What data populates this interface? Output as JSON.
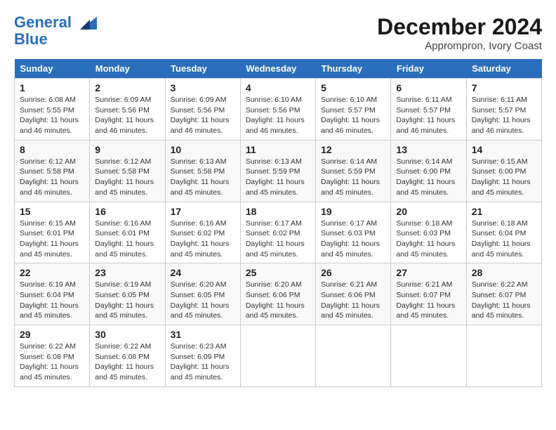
{
  "header": {
    "logo_line1": "General",
    "logo_line2": "Blue",
    "month": "December 2024",
    "location": "Apprompron, Ivory Coast"
  },
  "columns": [
    "Sunday",
    "Monday",
    "Tuesday",
    "Wednesday",
    "Thursday",
    "Friday",
    "Saturday"
  ],
  "weeks": [
    [
      {
        "day": "1",
        "sunrise": "6:08 AM",
        "sunset": "5:55 PM",
        "daylight": "11 hours and 46 minutes."
      },
      {
        "day": "2",
        "sunrise": "6:09 AM",
        "sunset": "5:56 PM",
        "daylight": "11 hours and 46 minutes."
      },
      {
        "day": "3",
        "sunrise": "6:09 AM",
        "sunset": "5:56 PM",
        "daylight": "11 hours and 46 minutes."
      },
      {
        "day": "4",
        "sunrise": "6:10 AM",
        "sunset": "5:56 PM",
        "daylight": "11 hours and 46 minutes."
      },
      {
        "day": "5",
        "sunrise": "6:10 AM",
        "sunset": "5:57 PM",
        "daylight": "11 hours and 46 minutes."
      },
      {
        "day": "6",
        "sunrise": "6:11 AM",
        "sunset": "5:57 PM",
        "daylight": "11 hours and 46 minutes."
      },
      {
        "day": "7",
        "sunrise": "6:11 AM",
        "sunset": "5:57 PM",
        "daylight": "11 hours and 46 minutes."
      }
    ],
    [
      {
        "day": "8",
        "sunrise": "6:12 AM",
        "sunset": "5:58 PM",
        "daylight": "11 hours and 46 minutes."
      },
      {
        "day": "9",
        "sunrise": "6:12 AM",
        "sunset": "5:58 PM",
        "daylight": "11 hours and 45 minutes."
      },
      {
        "day": "10",
        "sunrise": "6:13 AM",
        "sunset": "5:58 PM",
        "daylight": "11 hours and 45 minutes."
      },
      {
        "day": "11",
        "sunrise": "6:13 AM",
        "sunset": "5:59 PM",
        "daylight": "11 hours and 45 minutes."
      },
      {
        "day": "12",
        "sunrise": "6:14 AM",
        "sunset": "5:59 PM",
        "daylight": "11 hours and 45 minutes."
      },
      {
        "day": "13",
        "sunrise": "6:14 AM",
        "sunset": "6:00 PM",
        "daylight": "11 hours and 45 minutes."
      },
      {
        "day": "14",
        "sunrise": "6:15 AM",
        "sunset": "6:00 PM",
        "daylight": "11 hours and 45 minutes."
      }
    ],
    [
      {
        "day": "15",
        "sunrise": "6:15 AM",
        "sunset": "6:01 PM",
        "daylight": "11 hours and 45 minutes."
      },
      {
        "day": "16",
        "sunrise": "6:16 AM",
        "sunset": "6:01 PM",
        "daylight": "11 hours and 45 minutes."
      },
      {
        "day": "17",
        "sunrise": "6:16 AM",
        "sunset": "6:02 PM",
        "daylight": "11 hours and 45 minutes."
      },
      {
        "day": "18",
        "sunrise": "6:17 AM",
        "sunset": "6:02 PM",
        "daylight": "11 hours and 45 minutes."
      },
      {
        "day": "19",
        "sunrise": "6:17 AM",
        "sunset": "6:03 PM",
        "daylight": "11 hours and 45 minutes."
      },
      {
        "day": "20",
        "sunrise": "6:18 AM",
        "sunset": "6:03 PM",
        "daylight": "11 hours and 45 minutes."
      },
      {
        "day": "21",
        "sunrise": "6:18 AM",
        "sunset": "6:04 PM",
        "daylight": "11 hours and 45 minutes."
      }
    ],
    [
      {
        "day": "22",
        "sunrise": "6:19 AM",
        "sunset": "6:04 PM",
        "daylight": "11 hours and 45 minutes."
      },
      {
        "day": "23",
        "sunrise": "6:19 AM",
        "sunset": "6:05 PM",
        "daylight": "11 hours and 45 minutes."
      },
      {
        "day": "24",
        "sunrise": "6:20 AM",
        "sunset": "6:05 PM",
        "daylight": "11 hours and 45 minutes."
      },
      {
        "day": "25",
        "sunrise": "6:20 AM",
        "sunset": "6:06 PM",
        "daylight": "11 hours and 45 minutes."
      },
      {
        "day": "26",
        "sunrise": "6:21 AM",
        "sunset": "6:06 PM",
        "daylight": "11 hours and 45 minutes."
      },
      {
        "day": "27",
        "sunrise": "6:21 AM",
        "sunset": "6:07 PM",
        "daylight": "11 hours and 45 minutes."
      },
      {
        "day": "28",
        "sunrise": "6:22 AM",
        "sunset": "6:07 PM",
        "daylight": "11 hours and 45 minutes."
      }
    ],
    [
      {
        "day": "29",
        "sunrise": "6:22 AM",
        "sunset": "6:08 PM",
        "daylight": "11 hours and 45 minutes."
      },
      {
        "day": "30",
        "sunrise": "6:22 AM",
        "sunset": "6:08 PM",
        "daylight": "11 hours and 45 minutes."
      },
      {
        "day": "31",
        "sunrise": "6:23 AM",
        "sunset": "6:09 PM",
        "daylight": "11 hours and 45 minutes."
      },
      null,
      null,
      null,
      null
    ]
  ]
}
